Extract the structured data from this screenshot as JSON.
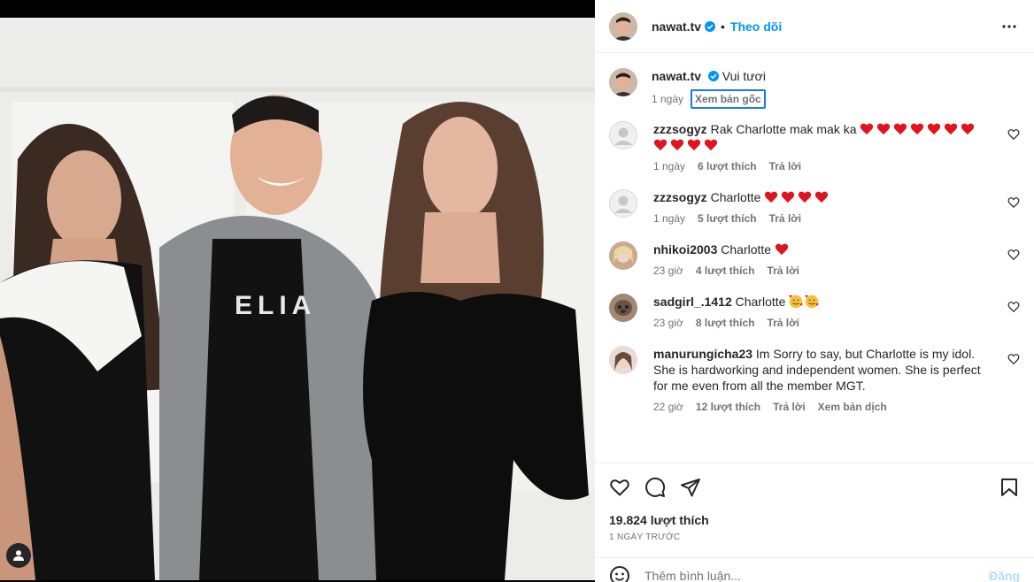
{
  "header": {
    "username": "nawat.tv",
    "separator": "•",
    "follow_label": "Theo dõi"
  },
  "caption": {
    "username": "nawat.tv",
    "text": "Vui tươi",
    "time": "1 ngày",
    "see_original": "Xem bản gốc"
  },
  "comments": [
    {
      "username": "zzzsogyz",
      "text": "Rak Charlotte mak mak ka",
      "hearts": 11,
      "time": "1 ngày",
      "likes": "6 lượt thích",
      "reply": "Trả lời"
    },
    {
      "username": "zzzsogyz",
      "text": "Charlotte",
      "hearts": 4,
      "time": "1 ngày",
      "likes": "5 lượt thích",
      "reply": "Trả lời"
    },
    {
      "username": "nhikoi2003",
      "text": "Charlotte",
      "hearts": 1,
      "time": "23 giờ",
      "likes": "4 lượt thích",
      "reply": "Trả lời"
    },
    {
      "username": "sadgirl_.1412",
      "text": "Charlotte",
      "faces": 2,
      "time": "23 giờ",
      "likes": "8 lượt thích",
      "reply": "Trả lời"
    },
    {
      "username": "manurungicha23",
      "text": "Im Sorry to say, but Charlotte is my idol. She is hardworking and independent women. She is perfect for me even from all the member MGT.",
      "time": "22 giờ",
      "likes": "12 lượt thích",
      "reply": "Trả lời",
      "translate": "Xem bản dịch"
    }
  ],
  "post": {
    "likes": "19.824 lượt thích",
    "date": "1 ngày trước"
  },
  "add_comment": {
    "placeholder": "Thêm bình luận...",
    "post_label": "Đăng"
  },
  "photo": {
    "shirt_text": "ELIA"
  },
  "icons": {
    "verified": "verified-badge-icon",
    "more": "more-options-icon",
    "like": "heart-outline-icon",
    "comment": "comment-bubble-icon",
    "share": "paper-plane-icon",
    "save": "bookmark-icon",
    "emoji": "smiley-icon",
    "tag": "user-tag-icon"
  },
  "colors": {
    "accent": "#0095f6",
    "heart": "#e0141f",
    "focus": "#1877f2"
  }
}
